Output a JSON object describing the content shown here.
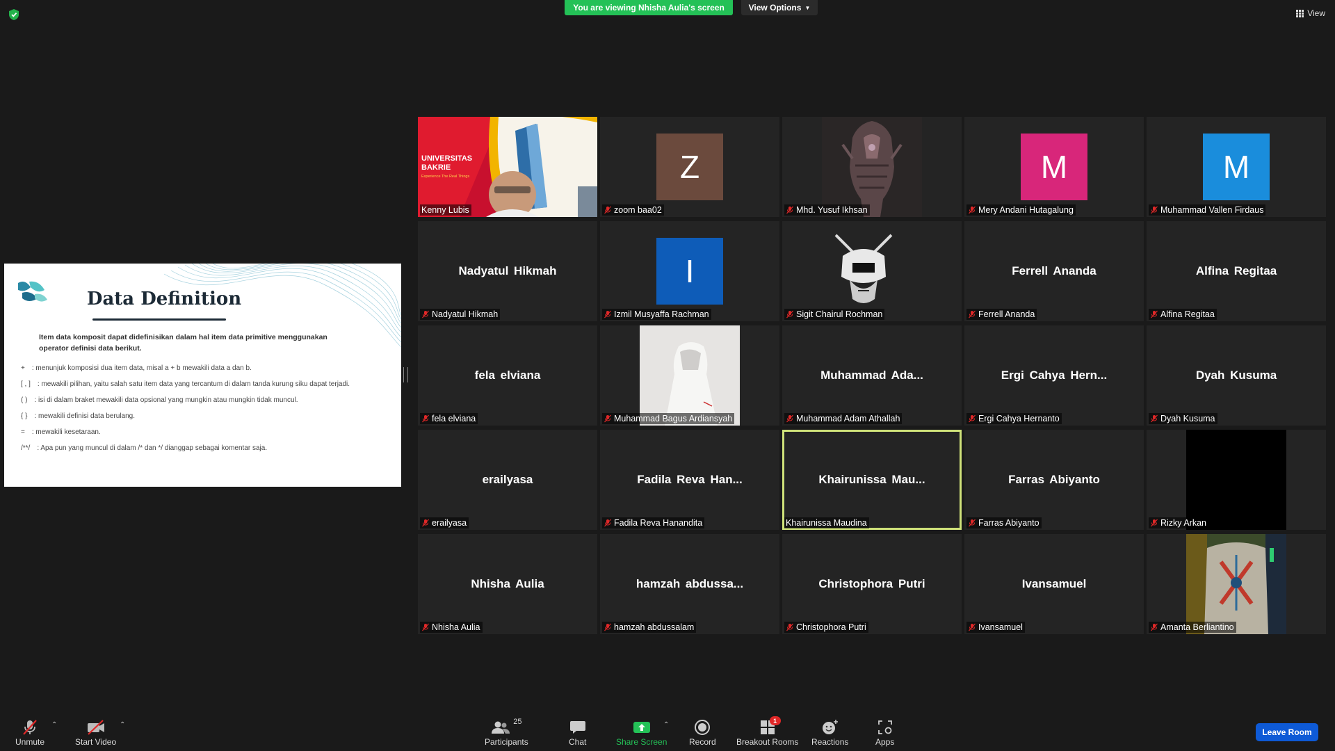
{
  "banner": {
    "viewing": "You are viewing Nhisha Aulia's screen",
    "view_options": "View Options",
    "view": "View"
  },
  "slide": {
    "title": "Data Definition",
    "intro": "Item data komposit dapat didefinisikan dalam hal item data primitive menggunakan operator definisi data berikut.",
    "items": [
      {
        "sym": "+",
        "text": ": menunjuk komposisi dua item data, misal a + b mewakili data a dan b."
      },
      {
        "sym": "[ , ]",
        "text": ": mewakili pilihan, yaitu salah satu item data yang tercantum di dalam tanda kurung siku dapat terjadi."
      },
      {
        "sym": "( )",
        "text": ": isi di dalam braket mewakili data opsional yang mungkin atau mungkin tidak muncul."
      },
      {
        "sym": "{ }",
        "text": ": mewakili definisi data berulang."
      },
      {
        "sym": "=",
        "text": ": mewakili kesetaraan."
      },
      {
        "sym": "/**/",
        "text": ": Apa pun yang muncul di dalam /* dan */ dianggap sebagai komentar saja."
      }
    ]
  },
  "video_tile": {
    "line1": "UNIVERSITAS",
    "line2": "BAKRIE",
    "tagline": "Experience The Real Things"
  },
  "participants": [
    {
      "name": "Kenny Lubis",
      "display": "",
      "muted": false,
      "kind": "video"
    },
    {
      "name": "zoom baa02",
      "display": "",
      "muted": true,
      "kind": "avatar",
      "initial": "Z",
      "color": "#6b4a3d"
    },
    {
      "name": "Mhd. Yusuf Ikhsan",
      "display": "",
      "muted": true,
      "kind": "picture",
      "art": "robot"
    },
    {
      "name": "Mery Andani Hutagalung",
      "display": "",
      "muted": true,
      "kind": "avatar",
      "initial": "M",
      "color": "#d8267a"
    },
    {
      "name": "Muhammad Vallen Firdaus",
      "display": "",
      "muted": true,
      "kind": "avatar",
      "initial": "M",
      "color": "#1a8ddc"
    },
    {
      "name": "Nadyatul Hikmah",
      "display": "Nadyatul Hikmah",
      "muted": true,
      "kind": "name"
    },
    {
      "name": "Izmil Musyaffa Rachman",
      "display": "",
      "muted": true,
      "kind": "avatar",
      "initial": "I",
      "color": "#0e5cb8"
    },
    {
      "name": "Sigit Chairul Rochman",
      "display": "",
      "muted": true,
      "kind": "picture",
      "art": "samurai"
    },
    {
      "name": "Ferrell Ananda",
      "display": "Ferrell Ananda",
      "muted": true,
      "kind": "name"
    },
    {
      "name": "Alfina Regitaa",
      "display": "Alfina Regitaa",
      "muted": true,
      "kind": "name"
    },
    {
      "name": "fela elviana",
      "display": "fela elviana",
      "muted": true,
      "kind": "name"
    },
    {
      "name": "Muhammad Bagus Ardiansyah",
      "display": "",
      "muted": true,
      "kind": "picture",
      "art": "hoodie"
    },
    {
      "name": "Muhammad Adam Athallah",
      "display": "Muhammad  Ada...",
      "muted": true,
      "kind": "name"
    },
    {
      "name": "Ergi Cahya Hernanto",
      "display": "Ergi Cahya Hern...",
      "muted": true,
      "kind": "name"
    },
    {
      "name": "Dyah Kusuma",
      "display": "Dyah Kusuma",
      "muted": true,
      "kind": "name"
    },
    {
      "name": "erailyasa",
      "display": "erailyasa",
      "muted": true,
      "kind": "name"
    },
    {
      "name": "Fadila Reva Hanandita",
      "display": "Fadila  Reva  Han...",
      "muted": true,
      "kind": "name"
    },
    {
      "name": "Khairunissa Maudina",
      "display": "Khairunissa  Mau...",
      "muted": false,
      "kind": "name",
      "active": true
    },
    {
      "name": "Farras Abiyanto",
      "display": "Farras Abiyanto",
      "muted": true,
      "kind": "name"
    },
    {
      "name": "Rizky Arkan",
      "display": "",
      "muted": true,
      "kind": "picture",
      "art": "black"
    },
    {
      "name": "Nhisha Aulia",
      "display": "Nhisha Aulia",
      "muted": true,
      "kind": "name"
    },
    {
      "name": "hamzah abdussalam",
      "display": "hamzah  abdussa...",
      "muted": true,
      "kind": "name"
    },
    {
      "name": "Christophora Putri",
      "display": "Christophora Putri",
      "muted": true,
      "kind": "name"
    },
    {
      "name": "Ivansamuel",
      "display": "Ivansamuel",
      "muted": true,
      "kind": "name"
    },
    {
      "name": "Amanta Berliantino",
      "display": "",
      "muted": true,
      "kind": "picture",
      "art": "jacket"
    }
  ],
  "toolbar": {
    "unmute": "Unmute",
    "start_video": "Start Video",
    "participants": "Participants",
    "participants_count": "25",
    "chat": "Chat",
    "share_screen": "Share Screen",
    "record": "Record",
    "breakout_rooms": "Breakout Rooms",
    "breakout_badge": "1",
    "reactions": "Reactions",
    "apps": "Apps",
    "leave": "Leave Room"
  },
  "colors": {
    "share_green": "#24c157",
    "leave_blue": "#0e5ad6",
    "active_border": "#cfe27a",
    "mute_red": "#e02828"
  }
}
